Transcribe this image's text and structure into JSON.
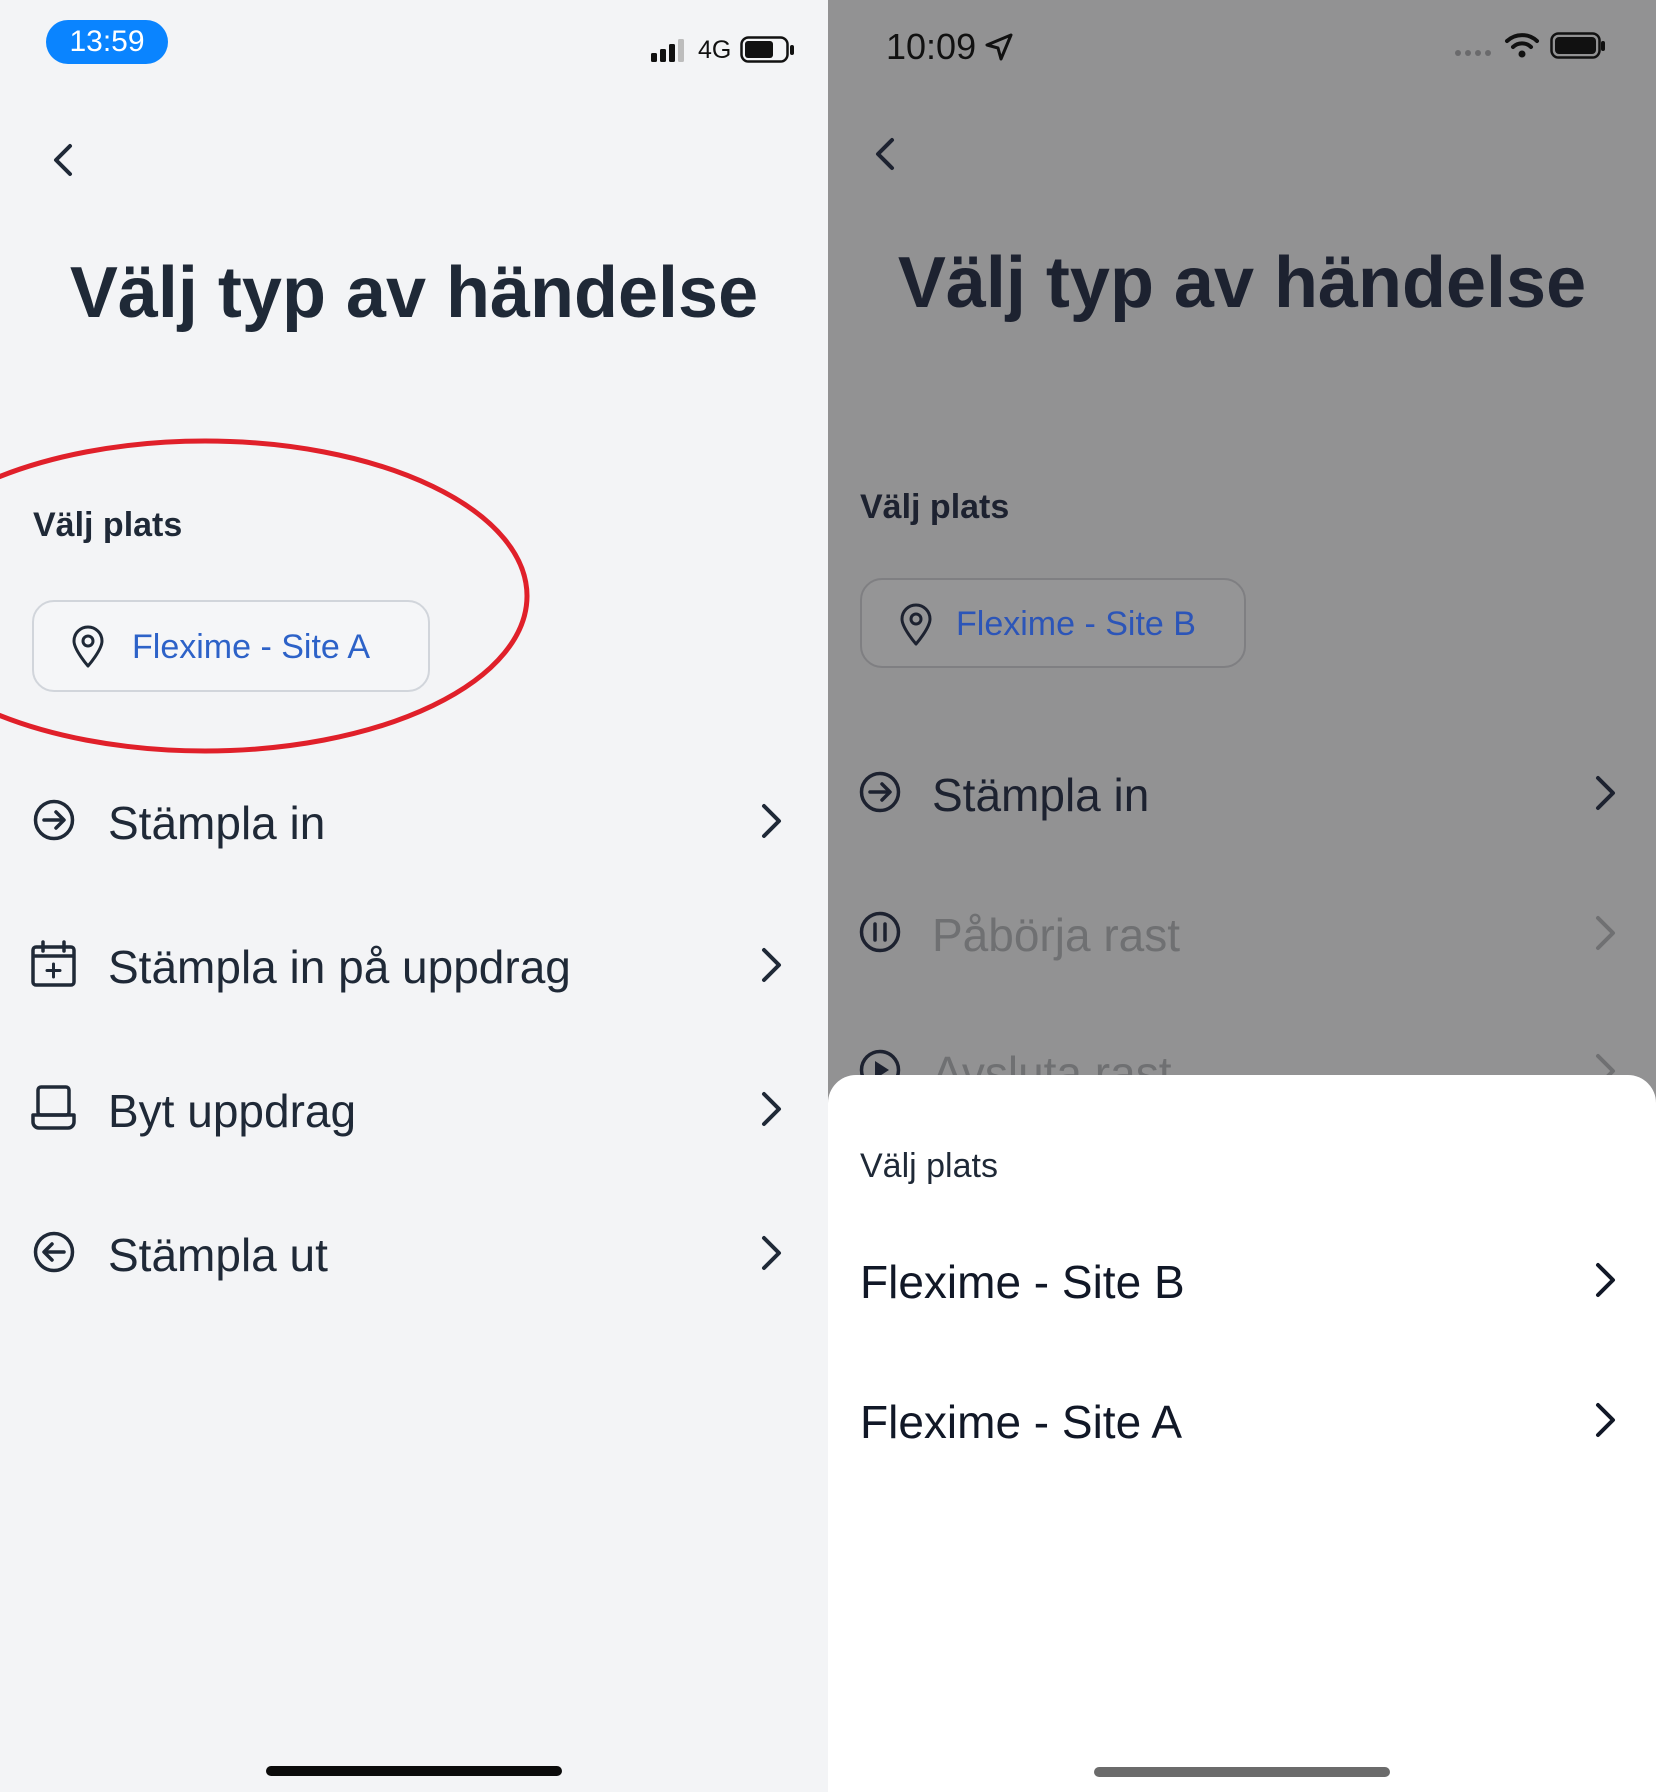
{
  "left": {
    "status_bar": {
      "time": "13:59",
      "network": "4G"
    },
    "title": "Välj typ av händelse",
    "location_section": {
      "label": "Välj plats",
      "selected": "Flexime - Site A"
    },
    "menu": [
      {
        "label": "Stämpla in",
        "icon": "arrow-right-circle-icon"
      },
      {
        "label": "Stämpla in på uppdrag",
        "icon": "calendar-plus-icon"
      },
      {
        "label": "Byt uppdrag",
        "icon": "laptop-icon"
      },
      {
        "label": "Stämpla ut",
        "icon": "arrow-left-circle-icon"
      }
    ],
    "annotation_color": "#e0202a"
  },
  "right": {
    "status_bar": {
      "time": "10:09"
    },
    "title": "Välj typ av händelse",
    "location_section": {
      "label": "Välj plats",
      "selected": "Flexime - Site B"
    },
    "menu": [
      {
        "label": "Stämpla in",
        "icon": "arrow-right-circle-icon"
      },
      {
        "label": "Påbörja rast",
        "icon": "pause-circle-icon"
      },
      {
        "label": "Avsluta rast",
        "icon": "play-circle-icon"
      }
    ],
    "sheet": {
      "title": "Välj plats",
      "options": [
        "Flexime - Site B",
        "Flexime - Site A"
      ]
    }
  },
  "colors": {
    "accent_blue": "#2d62c8",
    "status_pill": "#0a84ff",
    "text_dark": "#1f2937"
  }
}
